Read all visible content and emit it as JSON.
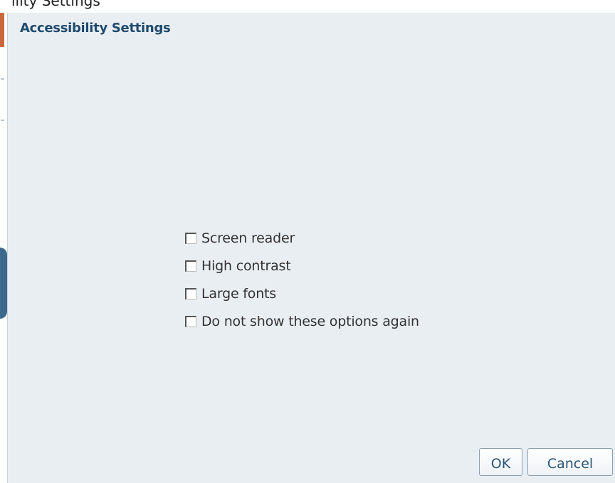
{
  "background": {
    "partial_title_text": "ility Settings"
  },
  "dialog": {
    "title": "Accessibility Settings",
    "options": [
      {
        "label": "Screen reader",
        "checked": false
      },
      {
        "label": "High contrast",
        "checked": false
      },
      {
        "label": "Large fonts",
        "checked": false
      },
      {
        "label": "Do not show these options again",
        "checked": false
      }
    ],
    "buttons": {
      "ok_label": "OK",
      "cancel_label": "Cancel"
    }
  },
  "colors": {
    "dialog_background": "#e9eef3",
    "title_color": "#1e4a6e",
    "button_text": "#2c5577",
    "accent_orange": "#c9683f"
  }
}
